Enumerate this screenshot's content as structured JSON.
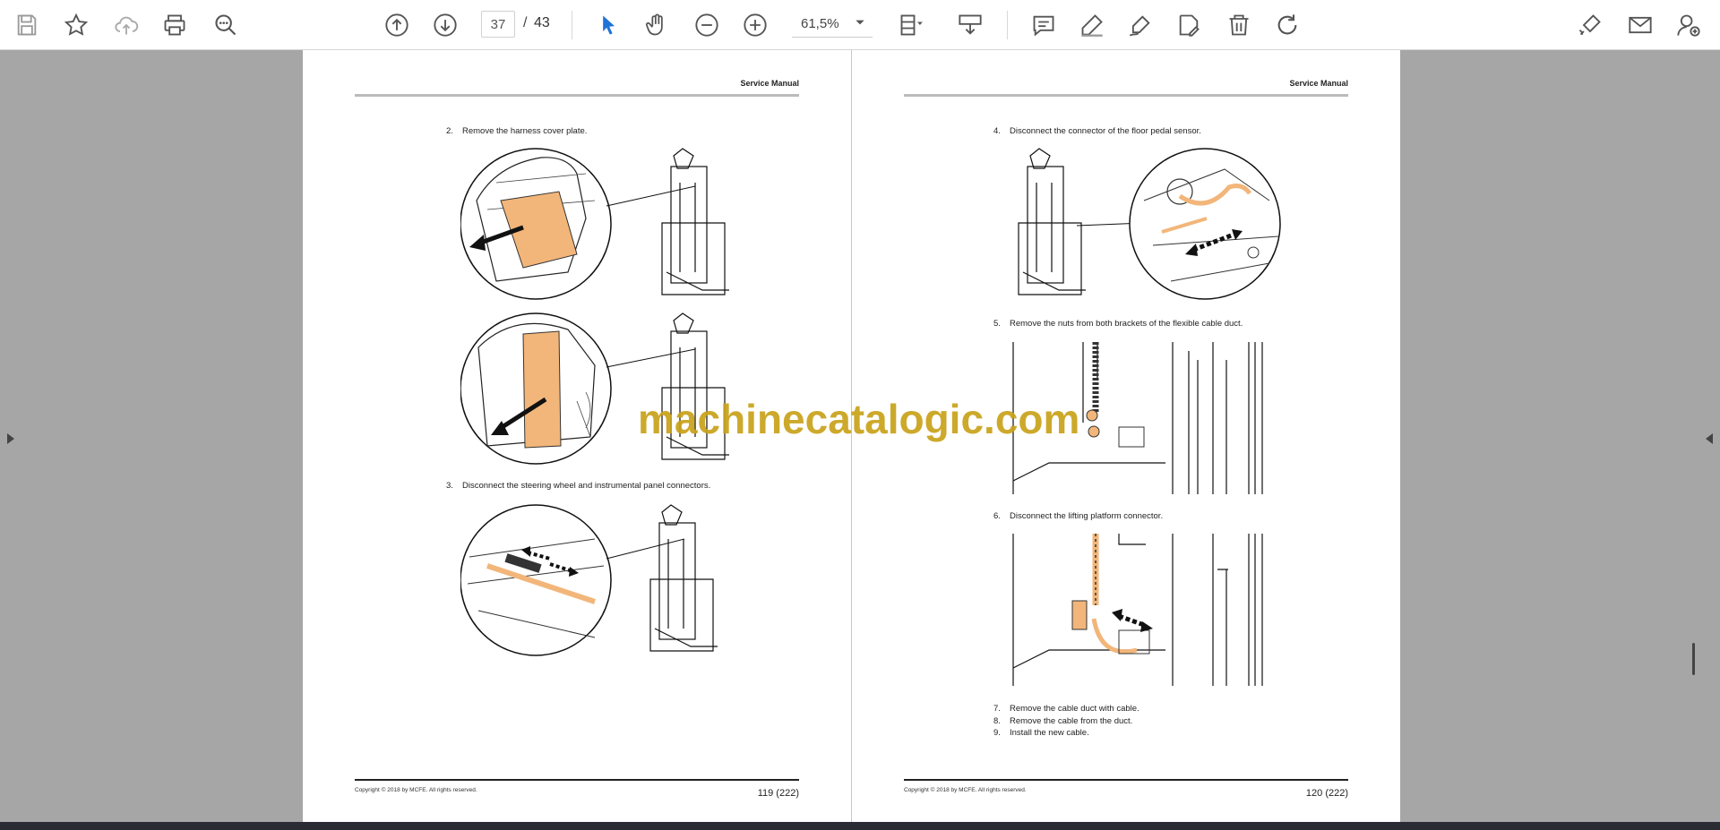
{
  "toolbar": {
    "current_page": "37",
    "page_separator": "/",
    "total_pages": "43",
    "zoom": "61,5%",
    "icons": [
      "save-icon",
      "bookmark-star-icon",
      "upload-cloud-icon",
      "print-icon",
      "find-zoom-icon",
      "page-up-icon",
      "page-down-icon",
      "select-cursor-icon",
      "hand-tool-icon",
      "zoom-out-icon",
      "zoom-in-icon",
      "page-view-icon",
      "scroll-mode-icon",
      "comment-icon",
      "highlight-icon",
      "draw-icon",
      "stamp-icon",
      "delete-icon",
      "rotate-icon",
      "sign-icon",
      "email-icon",
      "add-user-icon"
    ]
  },
  "left_page": {
    "header": "Service Manual",
    "steps": [
      {
        "num": "2.",
        "text": "Remove the harness cover plate."
      },
      {
        "num": "3.",
        "text": "Disconnect the steering wheel and instrumental panel connectors."
      }
    ],
    "copyright": "Copyright © 2018 by MCFE. All rights reserved.",
    "page_number": "119 (222)"
  },
  "right_page": {
    "header": "Service Manual",
    "steps": [
      {
        "num": "4.",
        "text": "Disconnect the connector of the floor pedal sensor."
      },
      {
        "num": "5.",
        "text": "Remove the nuts from both brackets of the flexible cable duct."
      },
      {
        "num": "6.",
        "text": "Disconnect the lifting platform connector."
      },
      {
        "num": "7.",
        "text": "Remove the cable duct with cable."
      },
      {
        "num": "8.",
        "text": "Remove the cable from the duct."
      },
      {
        "num": "9.",
        "text": "Install the new cable."
      }
    ],
    "copyright": "Copyright © 2018 by MCFE. All rights reserved.",
    "page_number": "120 (222)"
  },
  "watermark": "machinecatalogic.com",
  "colors": {
    "accent_blue": "#1e73d8",
    "highlight_orange": "#f2b67a",
    "watermark": "#c9a21a",
    "icon_gray": "#555555"
  }
}
